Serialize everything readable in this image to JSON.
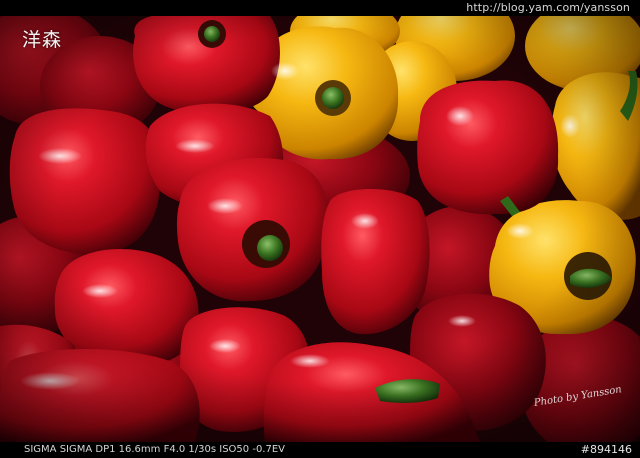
{
  "header": {
    "url": "http://blog.yam.com/yansson"
  },
  "watermark": {
    "logo_text": "洋森",
    "signature": "Photo by Yansson"
  },
  "footer": {
    "exif": "SIGMA SIGMA DP1 16.6mm F4.0 1/30s ISO50 -0.7EV",
    "photo_id": "#894146"
  },
  "photo": {
    "subject": "pile-of-bell-peppers",
    "colors": {
      "red": "#c0101c",
      "yellow": "#f0b000",
      "stem": "#2f6a1c",
      "background": "#1a0305"
    }
  }
}
